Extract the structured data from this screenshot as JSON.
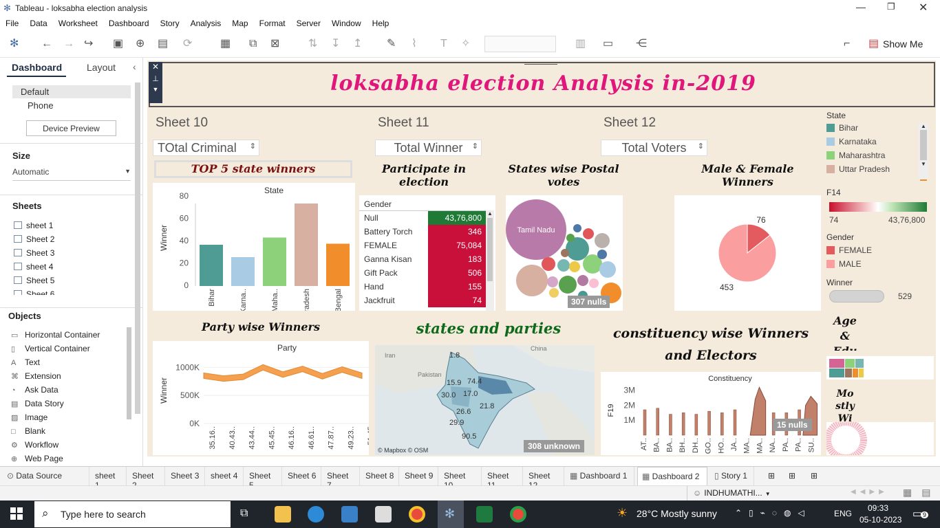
{
  "window": {
    "title": "Tableau - loksabha election analysis"
  },
  "menu": [
    "File",
    "Data",
    "Worksheet",
    "Dashboard",
    "Story",
    "Analysis",
    "Map",
    "Format",
    "Server",
    "Window",
    "Help"
  ],
  "toolbar": {
    "show_me": "Show Me"
  },
  "left": {
    "tabs": {
      "dashboard": "Dashboard",
      "layout": "Layout"
    },
    "devices": {
      "default": "Default",
      "phone": "Phone",
      "preview": "Device Preview"
    },
    "size": {
      "title": "Size",
      "value": "Automatic"
    },
    "sheets": {
      "title": "Sheets",
      "items": [
        "sheet 1",
        "Sheet 2",
        "Sheet 3",
        "sheet 4",
        "Sheet 5",
        "Sheet 6"
      ]
    },
    "objects": {
      "title": "Objects",
      "items": [
        "Horizontal Container",
        "Vertical Container",
        "Text",
        "Extension",
        "Ask Data",
        "Data Story",
        "Image",
        "Blank",
        "Workflow",
        "Web Page"
      ]
    }
  },
  "dashboard": {
    "title": "loksabha election Analysis in-2019",
    "sheet10": "Sheet 10",
    "sheet11": "Sheet 11",
    "sheet12": "Sheet 12",
    "dd_criminal": "TOtal Criminal",
    "dd_winner": "Total Winner",
    "dd_voters": "Total Voters",
    "heading_top5": "TOP 5 state winners",
    "heading_participate": "Participate in election",
    "heading_postal": "States wise Postal votes",
    "heading_malefemale": "Male & Female Winners",
    "heading_party": "Party wise Winners",
    "heading_states_parties": "states and parties",
    "heading_constituency": "constituency wise Winners and Electors",
    "heading_age": "Age & Edu",
    "heading_mostly": "Mo stly Wi",
    "postal_nulls": "307 nulls",
    "map_unknown": "308 unknown",
    "map_credit": "© Mapbox © OSM",
    "constituency_nulls": "15 nulls"
  },
  "chart_data": [
    {
      "type": "bar",
      "title": "State",
      "ylabel": "Winner",
      "categories": [
        "Bihar",
        "Karna..",
        "Maha..",
        "Uttar Pradesh",
        "West Bengal"
      ],
      "values": [
        40,
        28,
        47,
        80,
        41
      ],
      "ylim": [
        0,
        80
      ],
      "ticks": [
        "80",
        "60",
        "40",
        "20",
        "0"
      ],
      "colors": [
        "#4e9c94",
        "#a9cbe3",
        "#8dd27b",
        "#d7b0a2",
        "#f28d2c"
      ]
    },
    {
      "type": "table",
      "header": "Gender",
      "rows": [
        {
          "label": "Null",
          "value": "43,76,800"
        },
        {
          "label": "Battery Torch",
          "value": "346"
        },
        {
          "label": "FEMALE",
          "value": "75,084"
        },
        {
          "label": "Ganna Kisan",
          "value": "183"
        },
        {
          "label": "Gift Pack",
          "value": "506"
        },
        {
          "label": "Hand",
          "value": "155"
        },
        {
          "label": "Jackfruit",
          "value": "74"
        }
      ]
    },
    {
      "type": "pie",
      "slices": [
        {
          "label": "76",
          "value": 76,
          "color": "#e35a5f"
        },
        {
          "label": "453",
          "value": 453,
          "color": "#fb9ea0"
        }
      ]
    },
    {
      "type": "area",
      "title": "Party",
      "ylabel": "Winner",
      "ticks": [
        "1000K",
        "500K",
        "0K"
      ],
      "ylim": [
        0,
        1200000
      ],
      "x": [
        "35.16..",
        "40.43..",
        "43.44..",
        "45.45..",
        "46.16..",
        "46.61..",
        "47.87..",
        "49.23..",
        "51.45"
      ],
      "values": [
        900000,
        850000,
        880000,
        1050000,
        920000,
        1020000,
        890000,
        1010000,
        900000
      ]
    },
    {
      "type": "area",
      "title": "Constituency",
      "ylabel": "F19",
      "ticks": [
        "3M",
        "2M",
        "1M"
      ],
      "ylim": [
        0,
        3400000
      ],
      "x": [
        "AT..",
        "BA..",
        "BA..",
        "BH..",
        "DH..",
        "GO..",
        "HO..",
        "JA..",
        "MA..",
        "MA..",
        "NA..",
        "PA..",
        "PA..",
        "SU.."
      ],
      "values": [
        1700000,
        1800000,
        1400000,
        1500000,
        1400000,
        1600000,
        1500000,
        1700000,
        2400000,
        3200000,
        1500000,
        1500000,
        1700000,
        2600000
      ]
    }
  ],
  "legends": {
    "state_title": "State",
    "states": [
      {
        "label": "Bihar",
        "color": "#4e9c94"
      },
      {
        "label": "Karnataka",
        "color": "#a9cbe3"
      },
      {
        "label": "Maharashtra",
        "color": "#8dd27b"
      },
      {
        "label": "Uttar Pradesh",
        "color": "#d7b0a2"
      }
    ],
    "f14_title": "F14",
    "f14_min": "74",
    "f14_max": "43,76,800",
    "gender_title": "Gender",
    "genders": [
      {
        "label": "FEMALE",
        "color": "#e35a5f"
      },
      {
        "label": "MALE",
        "color": "#fb9ea0"
      }
    ],
    "winner_title": "Winner",
    "winner_value": "529"
  },
  "postal": {
    "bubble_label": "Tamil Nadu"
  },
  "tabs": [
    "Data Source",
    "sheet 1",
    "Sheet 2",
    "Sheet 3",
    "sheet 4",
    "Sheet 5",
    "Sheet 6",
    "Sheet 7",
    "Sheet 8",
    "Sheet 9",
    "Sheet 10",
    "Sheet 11",
    "Sheet 12",
    "Dashboard 1",
    "Dashboard 2",
    "Story 1"
  ],
  "status": {
    "user": "INDHUMATHI..."
  },
  "taskbar": {
    "search": "Type here to search",
    "weather": "28°C  Mostly sunny",
    "lang": "ENG",
    "time": "09:33",
    "date": "05-10-2023",
    "notif": "9"
  }
}
